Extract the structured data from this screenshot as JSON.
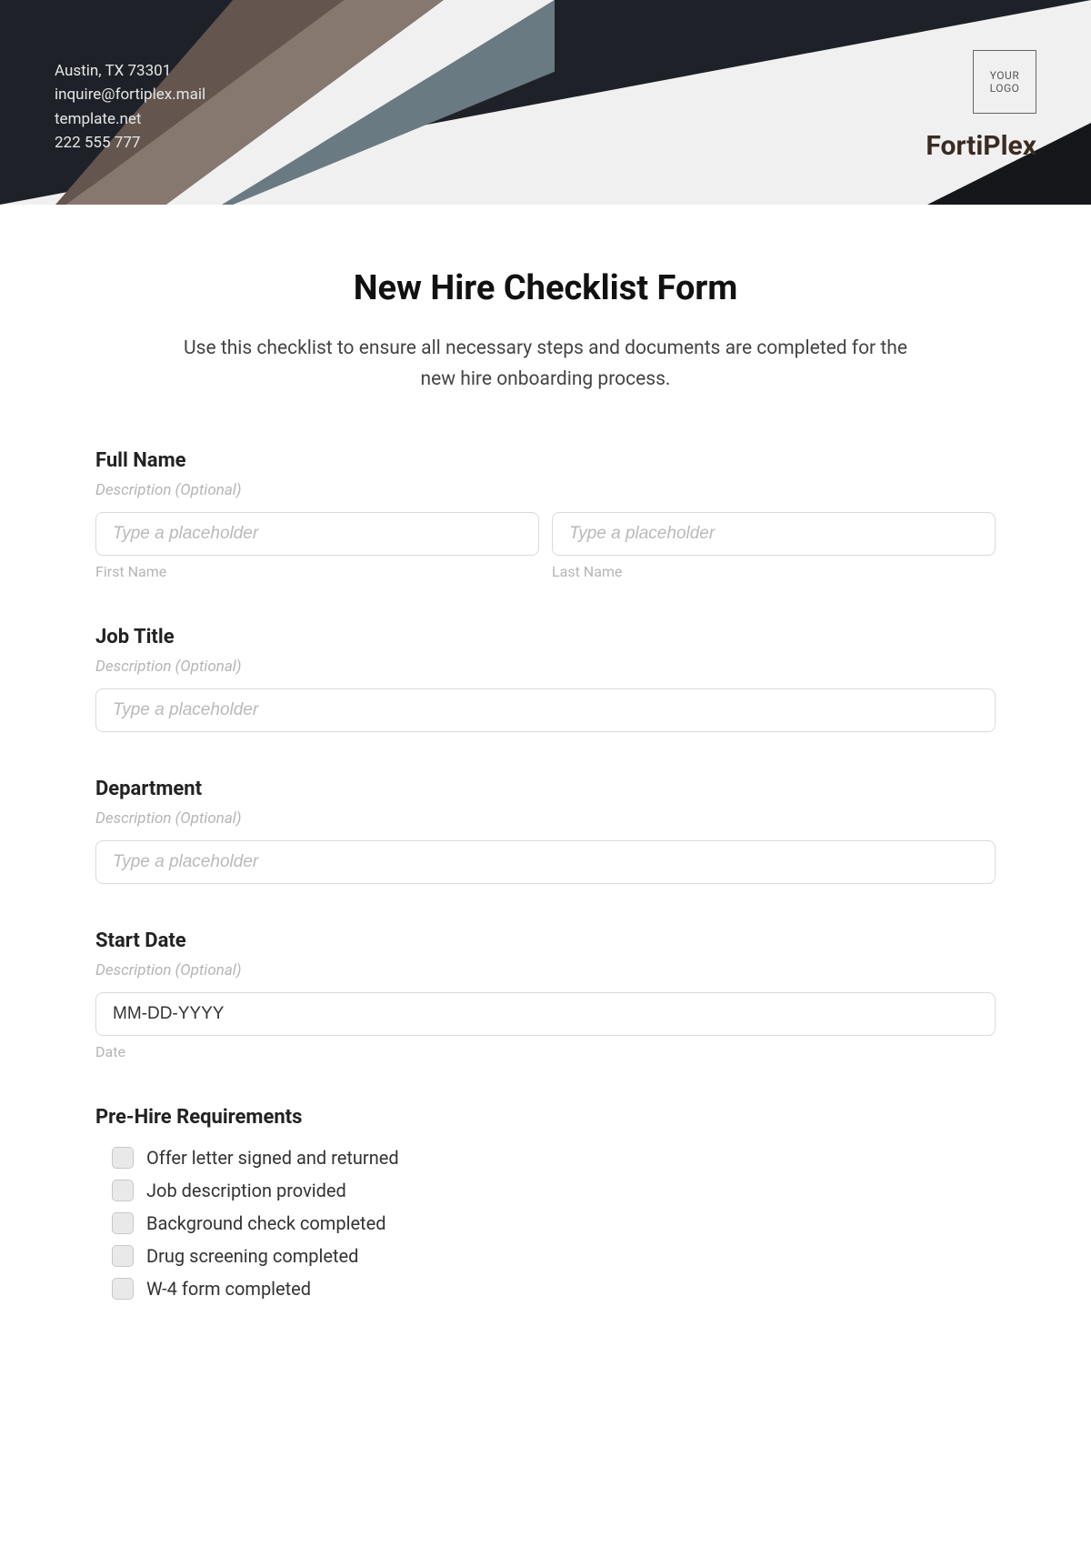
{
  "header": {
    "contact": {
      "address": "Austin, TX 73301",
      "email": "inquire@fortiplex.mail",
      "website": "template.net",
      "phone": "222 555 777"
    },
    "logo_text_1": "YOUR",
    "logo_text_2": "LOGO",
    "brand": "FortiPlex"
  },
  "form": {
    "title": "New Hire Checklist Form",
    "intro": "Use this checklist to ensure all necessary steps and documents are completed for the new hire onboarding process.",
    "full_name": {
      "label": "Full Name",
      "desc": "Description (Optional)",
      "first_placeholder": "Type a placeholder",
      "last_placeholder": "Type a placeholder",
      "first_sub": "First Name",
      "last_sub": "Last Name"
    },
    "job_title": {
      "label": "Job Title",
      "desc": "Description (Optional)",
      "placeholder": "Type a placeholder"
    },
    "department": {
      "label": "Department",
      "desc": "Description (Optional)",
      "placeholder": "Type a placeholder"
    },
    "start_date": {
      "label": "Start Date",
      "desc": "Description (Optional)",
      "value": "MM-DD-YYYY",
      "sub": "Date"
    },
    "prehire": {
      "heading": "Pre-Hire Requirements",
      "items": [
        "Offer letter signed and returned",
        "Job description provided",
        "Background check completed",
        "Drug screening completed",
        "W-4 form completed"
      ]
    }
  }
}
